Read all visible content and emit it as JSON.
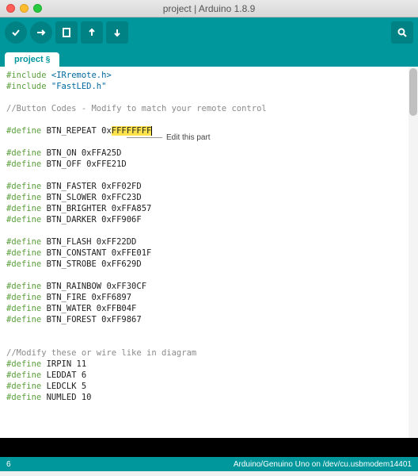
{
  "window": {
    "title": "project | Arduino 1.8.9"
  },
  "toolbar": {
    "verify": "verify-icon",
    "upload": "upload-icon",
    "new": "new-icon",
    "open": "open-icon",
    "save": "save-icon",
    "monitor": "serial-monitor-icon"
  },
  "tab": {
    "name": "project",
    "modified": "§"
  },
  "annotation": {
    "text": "Edit this part"
  },
  "code": {
    "lines": [
      [
        {
          "t": "#include ",
          "c": "kw"
        },
        {
          "t": "<IRremote.h>",
          "c": "str"
        }
      ],
      [
        {
          "t": "#include ",
          "c": "kw"
        },
        {
          "t": "\"FastLED.h\"",
          "c": "str"
        }
      ],
      [],
      [
        {
          "t": "//Button Codes - Modify to match your remote control",
          "c": "cm"
        }
      ],
      [],
      [
        {
          "t": "#define",
          "c": "kw"
        },
        {
          "t": " BTN_REPEAT 0x"
        },
        {
          "t": "FFFFFFFF",
          "c": "hl cursor"
        }
      ],
      [],
      [
        {
          "t": "#define",
          "c": "kw"
        },
        {
          "t": " BTN_ON 0xFFA25D"
        }
      ],
      [
        {
          "t": "#define",
          "c": "kw"
        },
        {
          "t": " BTN_OFF 0xFFE21D"
        }
      ],
      [],
      [
        {
          "t": "#define",
          "c": "kw"
        },
        {
          "t": " BTN_FASTER 0xFF02FD"
        }
      ],
      [
        {
          "t": "#define",
          "c": "kw"
        },
        {
          "t": " BTN_SLOWER 0xFFC23D"
        }
      ],
      [
        {
          "t": "#define",
          "c": "kw"
        },
        {
          "t": " BTN_BRIGHTER 0xFFA857"
        }
      ],
      [
        {
          "t": "#define",
          "c": "kw"
        },
        {
          "t": " BTN_DARKER 0xFF906F"
        }
      ],
      [],
      [
        {
          "t": "#define",
          "c": "kw"
        },
        {
          "t": " BTN_FLASH 0xFF22DD"
        }
      ],
      [
        {
          "t": "#define",
          "c": "kw"
        },
        {
          "t": " BTN_CONSTANT 0xFFE01F"
        }
      ],
      [
        {
          "t": "#define",
          "c": "kw"
        },
        {
          "t": " BTN_STROBE 0xFF629D"
        }
      ],
      [],
      [
        {
          "t": "#define",
          "c": "kw"
        },
        {
          "t": " BTN_RAINBOW 0xFF30CF"
        }
      ],
      [
        {
          "t": "#define",
          "c": "kw"
        },
        {
          "t": " BTN_FIRE 0xFF6897"
        }
      ],
      [
        {
          "t": "#define",
          "c": "kw"
        },
        {
          "t": " BTN_WATER 0xFFB04F"
        }
      ],
      [
        {
          "t": "#define",
          "c": "kw"
        },
        {
          "t": " BTN_FOREST 0xFF9867"
        }
      ],
      [],
      [],
      [
        {
          "t": "//Modify these or wire like in diagram",
          "c": "cm"
        }
      ],
      [
        {
          "t": "#define",
          "c": "kw"
        },
        {
          "t": " IRPIN 11"
        }
      ],
      [
        {
          "t": "#define",
          "c": "kw"
        },
        {
          "t": " LEDDAT 6"
        }
      ],
      [
        {
          "t": "#define",
          "c": "kw"
        },
        {
          "t": " LEDCLK 5"
        }
      ],
      [
        {
          "t": "#define",
          "c": "kw"
        },
        {
          "t": " NUMLED 10"
        }
      ]
    ]
  },
  "status": {
    "line": "6",
    "board": "Arduino/Genuino Uno on /dev/cu.usbmodem14401"
  }
}
